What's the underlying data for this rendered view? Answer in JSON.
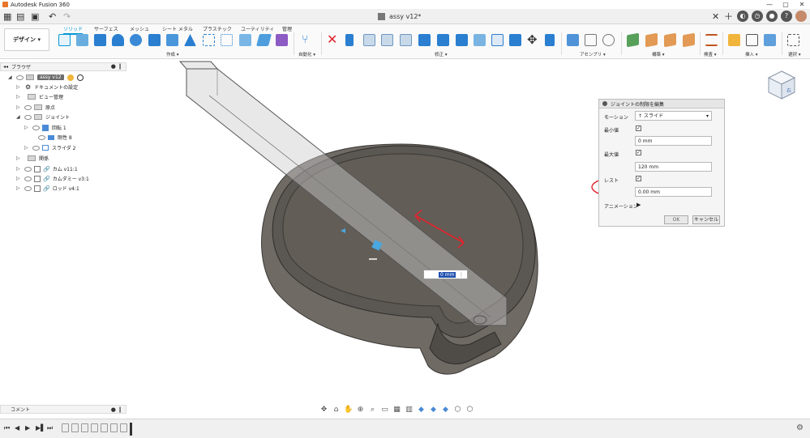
{
  "window": {
    "title": "Autodesk Fusion 360",
    "doc_tab": "assy v12*",
    "controls": [
      "—",
      "▢",
      "✕"
    ]
  },
  "ribbon": {
    "design_label": "デザイン ▾",
    "tabs": [
      "ソリッド",
      "サーフェス",
      "メッシュ",
      "シート メタル",
      "プラスチック",
      "ユーティリティ",
      "管理"
    ],
    "groups": [
      "作成 ▾",
      "自動化 ▾",
      "修正 ▾",
      "アセンブリ ▾",
      "構築 ▾",
      "検査 ▾",
      "挿入 ▾",
      "選択 ▾"
    ]
  },
  "browser": {
    "title": "ブラウザ",
    "items": [
      {
        "label": "assy v12",
        "depth": 0,
        "selected": true
      },
      {
        "label": "ドキュメントの設定",
        "depth": 1
      },
      {
        "label": "ビュー管理",
        "depth": 1
      },
      {
        "label": "原点",
        "depth": 1
      },
      {
        "label": "ジョイント",
        "depth": 1
      },
      {
        "label": "回転 1",
        "depth": 2
      },
      {
        "label": "剛性 8",
        "depth": 2
      },
      {
        "label": "スライダ 2",
        "depth": 2
      },
      {
        "label": "関係",
        "depth": 1
      },
      {
        "label": "カム v11:1",
        "depth": 1
      },
      {
        "label": "カムダミー v3:1",
        "depth": 1
      },
      {
        "label": "ロッド v4:1",
        "depth": 1
      }
    ]
  },
  "comments": {
    "label": "コメント"
  },
  "dialog": {
    "title": "ジョイントの制限を編集",
    "motion_label": "モーション",
    "motion_value": "スライド",
    "min_label": "最小値",
    "min_value": "0 mm",
    "max_label": "最大値",
    "max_value": "120 mm",
    "rest_label": "レスト",
    "rest_value": "0.00 mm",
    "animation_label": "アニメーション",
    "ok_label": "OK",
    "cancel_label": "キャンセル",
    "checkbox_mark": "✓"
  },
  "viewport": {
    "value_box": "0 mm",
    "viewcube_face": "右"
  },
  "colors": {
    "accent": "#0696d7",
    "annotation_red": "#e0232b",
    "model_body": "#6b6660"
  }
}
